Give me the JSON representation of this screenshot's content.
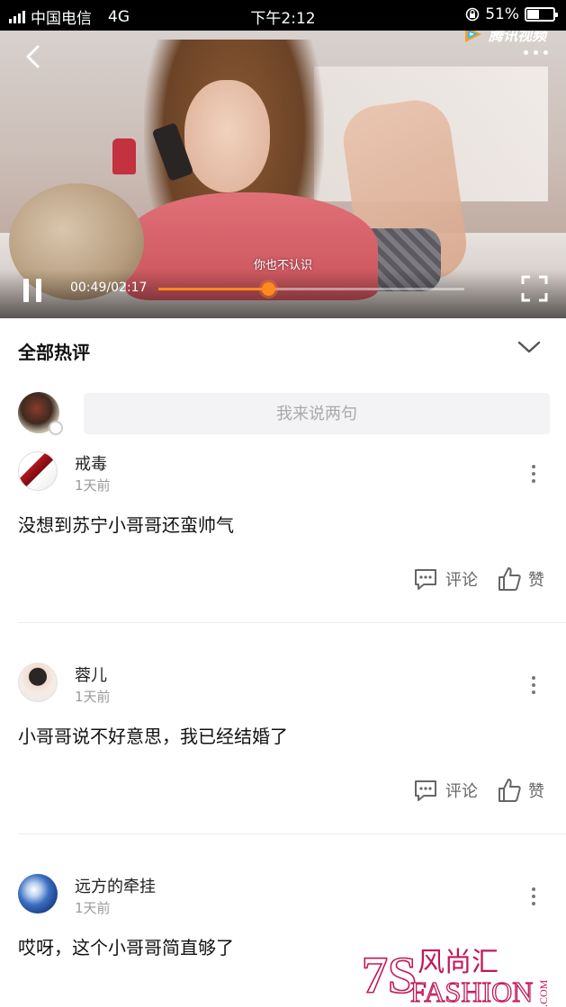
{
  "status_bar": {
    "carrier": "中国电信",
    "network": "4G",
    "time": "下午2:12",
    "battery": "51%",
    "battery_level": 0.51
  },
  "video": {
    "brand": "腾讯视频",
    "subtitle": "你也不认识",
    "time": "00:49/02:17",
    "progress": 0.36
  },
  "comments_section": {
    "title": "全部热评",
    "input_placeholder": "我来说两句"
  },
  "comments": [
    {
      "user": "戒毒",
      "time": "1天前",
      "text": "没想到苏宁小哥哥还蛮帅气",
      "reply_label": "评论",
      "like_label": "赞"
    },
    {
      "user": "蓉儿",
      "time": "1天前",
      "text": "小哥哥说不好意思，我已经结婚了",
      "reply_label": "评论",
      "like_label": "赞"
    },
    {
      "user": "远方的牵挂",
      "time": "1天前",
      "text": "哎呀，这个小哥哥简直够了"
    }
  ],
  "watermark": {
    "number": "7S",
    "name": "风尚汇",
    "latin": "FASHION",
    "domain": ".COM"
  },
  "colors": {
    "accent": "#ff8a1e",
    "status_bar_bg": "#000000",
    "input_bg": "#f3f3f5",
    "timestamp": "#9a9a9a"
  }
}
